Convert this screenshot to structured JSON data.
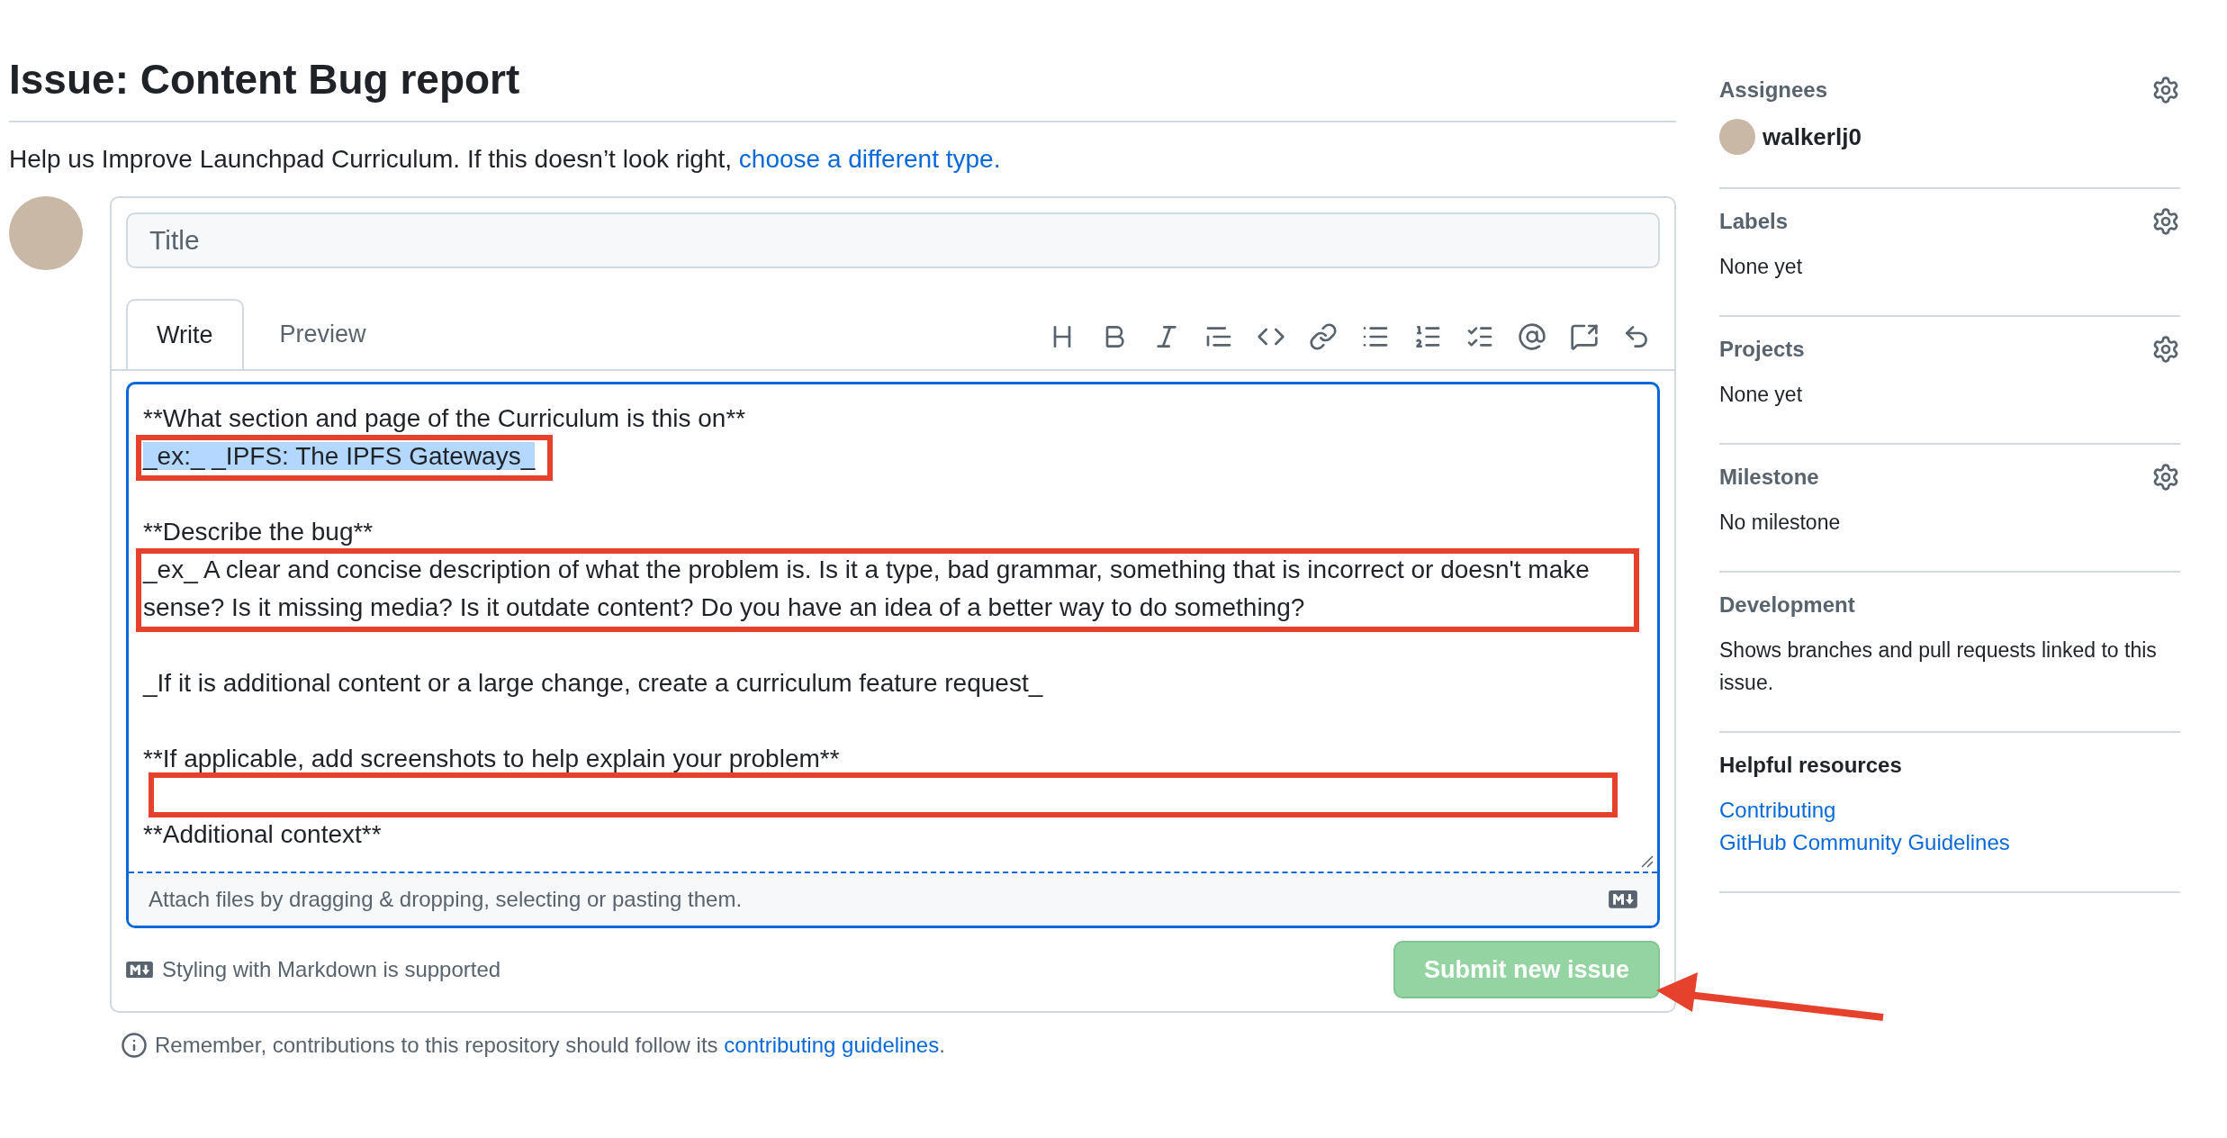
{
  "page_title": "Issue: Content Bug report",
  "subtitle": {
    "text": "Help us Improve Launchpad Curriculum. If this doesn’t look right,",
    "link": "choose a different type."
  },
  "title_field": {
    "placeholder": "Title"
  },
  "tabs": [
    {
      "label": "Write",
      "selected": true
    },
    {
      "label": "Preview",
      "selected": false
    }
  ],
  "editor": {
    "lines": [
      {
        "kind": "text",
        "text": "**What section and page of the Curriculum is this on**",
        "selected": false,
        "boxed": false
      },
      {
        "kind": "text",
        "text": "_ex:_  _IPFS: The IPFS Gateways_",
        "selected": true,
        "boxed": true
      },
      {
        "kind": "blank",
        "boxed": false
      },
      {
        "kind": "text",
        "text": "**Describe the bug**",
        "selected": false,
        "boxed": false
      },
      {
        "kind": "text",
        "text": "_ex_ A clear and concise description of what the problem is. Is it a type, bad grammar, something that is incorrect or doesn't make sense? Is it missing media? Is it outdate content? Do you have an idea of a better way to do something?",
        "selected": false,
        "boxed": true
      },
      {
        "kind": "blank",
        "boxed": false
      },
      {
        "kind": "text",
        "text": "_If it is additional content or a large change, create a curriculum feature request_",
        "selected": false,
        "boxed": false
      },
      {
        "kind": "blank",
        "boxed": false
      },
      {
        "kind": "text",
        "text": "**If applicable, add screenshots to help explain your problem**",
        "selected": false,
        "boxed": false
      },
      {
        "kind": "blank",
        "boxed": true
      },
      {
        "kind": "text",
        "text": "**Additional context**",
        "selected": false,
        "boxed": false
      }
    ],
    "attach_hint": "Attach files by dragging & dropping, selecting or pasting them."
  },
  "markdown_note": "Styling with Markdown is supported",
  "submit_button": {
    "label": "Submit new issue",
    "disabled": true
  },
  "footer_note": {
    "text": "Remember, contributions to this repository should follow its",
    "link": "contributing guidelines",
    "after": "."
  },
  "sidebar": [
    {
      "kind": "assignees",
      "heading": "Assignees",
      "settings": true,
      "user": "walkerlj0"
    },
    {
      "kind": "value",
      "heading": "Labels",
      "settings": true,
      "value": "None yet"
    },
    {
      "kind": "value",
      "heading": "Projects",
      "settings": true,
      "value": "None yet"
    },
    {
      "kind": "value",
      "heading": "Milestone",
      "settings": true,
      "value": "No milestone"
    },
    {
      "kind": "value",
      "heading": "Development",
      "settings": false,
      "value": "Shows branches and pull requests linked to this issue."
    },
    {
      "kind": "links",
      "heading": "Helpful resources",
      "settings": false,
      "links": [
        "Contributing",
        "GitHub Community Guidelines"
      ]
    }
  ]
}
